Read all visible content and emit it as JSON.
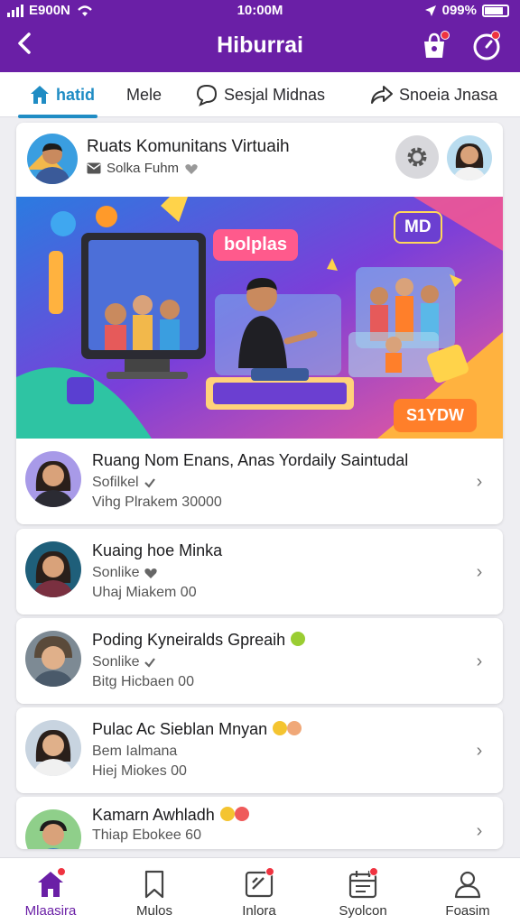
{
  "status_bar": {
    "carrier": "E900N",
    "time": "10:00M",
    "battery": "099%"
  },
  "header": {
    "title": "Hiburrai",
    "back_icon": "arrow-left-icon",
    "bag_icon": "shopping-bag-icon",
    "timer_icon": "timer-icon"
  },
  "tabs": [
    {
      "label": "hatid",
      "icon": "home-icon",
      "active": true
    },
    {
      "label": "Mele",
      "icon": "",
      "active": false
    },
    {
      "label": "Sesjal Midnas",
      "icon": "chat-bubble-icon",
      "active": false
    },
    {
      "label": "Snoeia Jnasa",
      "icon": "share-icon",
      "active": false
    }
  ],
  "feature": {
    "title": "Ruats Komunitans Virtuaih",
    "subtitle": "Solka Fuhm",
    "banner": {
      "label": "bolplas",
      "badge": "MD",
      "button": "S1YDW"
    },
    "row": {
      "title": "Ruang Nom Enans, Anas Yordaily Saintudal",
      "line1": "Sofilkel",
      "line2": "Vihg Plrakem 30000"
    }
  },
  "items": [
    {
      "title": "Kuaing hoe Minka",
      "line1": "Sonlike",
      "line2": "Uhaj Miakem 00"
    },
    {
      "title": "Poding Kyneiralds Gpreaih",
      "line1": "Sonlike",
      "line2": "Bitg Hicbaen 00"
    },
    {
      "title": "Pulac Ac Sieblan Mnyan",
      "line1": "Bem Ialmana",
      "line2": "Hiej Miokes 00"
    },
    {
      "title": "Kamarn Awhladh",
      "line1": "Thiap Ebokee 60",
      "line2": ""
    }
  ],
  "bottom_nav": [
    {
      "label": "Mlaasira",
      "icon": "home-icon",
      "active": true,
      "badge": true
    },
    {
      "label": "Mulos",
      "icon": "bookmark-icon",
      "active": false,
      "badge": false
    },
    {
      "label": "Inlora",
      "icon": "edit-icon",
      "active": false,
      "badge": true
    },
    {
      "label": "Syolcon",
      "icon": "calendar-icon",
      "active": false,
      "badge": true
    },
    {
      "label": "Foasim",
      "icon": "profile-icon",
      "active": false,
      "badge": false
    }
  ],
  "colors": {
    "brand": "#6a1fa6",
    "accent": "#1f8cc4",
    "badge": "#ef3340"
  }
}
